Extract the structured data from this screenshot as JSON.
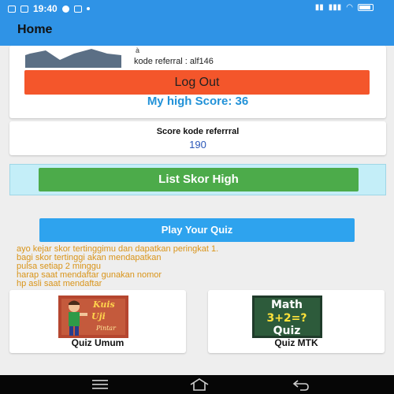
{
  "status_bar": {
    "time": "19:40",
    "extra": "≈ ◂"
  },
  "app_bar": {
    "title": "Home"
  },
  "profile": {
    "name": "à",
    "referral_line": "kode referral : alf146",
    "logout_label": "Log Out",
    "high_score_text": "My high Score: 36"
  },
  "referral": {
    "label": "Score kode referrral",
    "value": "190"
  },
  "list_button_label": "List Skor High",
  "play_button_label": "Play Your Quiz",
  "info_lines": [
    "ayo kejar skor tertinggimu dan dapatkan peringkat 1.",
    "bagi skor tertinggi akan mendapatkan",
    "pulsa setiap 2 minggu",
    "harap saat mendaftar gunakan nomor",
    "hp asli saat mendaftar"
  ],
  "quizzes": [
    {
      "label": "Quiz Umum",
      "icon": "kuis-uji-pintar-icon",
      "icon_text": [
        "Kuis",
        "Uji",
        "Pintar"
      ]
    },
    {
      "label": "Quiz MTK",
      "icon": "math-quiz-icon",
      "icon_text": [
        "Math",
        "3+2=?",
        "Quiz"
      ]
    }
  ],
  "colors": {
    "primary": "#2f93e6",
    "logout": "#f4562b",
    "high_score": "#2292d8",
    "list_button": "#4cab4a",
    "play_button": "#2ea3ee",
    "info_text": "#d99419"
  }
}
